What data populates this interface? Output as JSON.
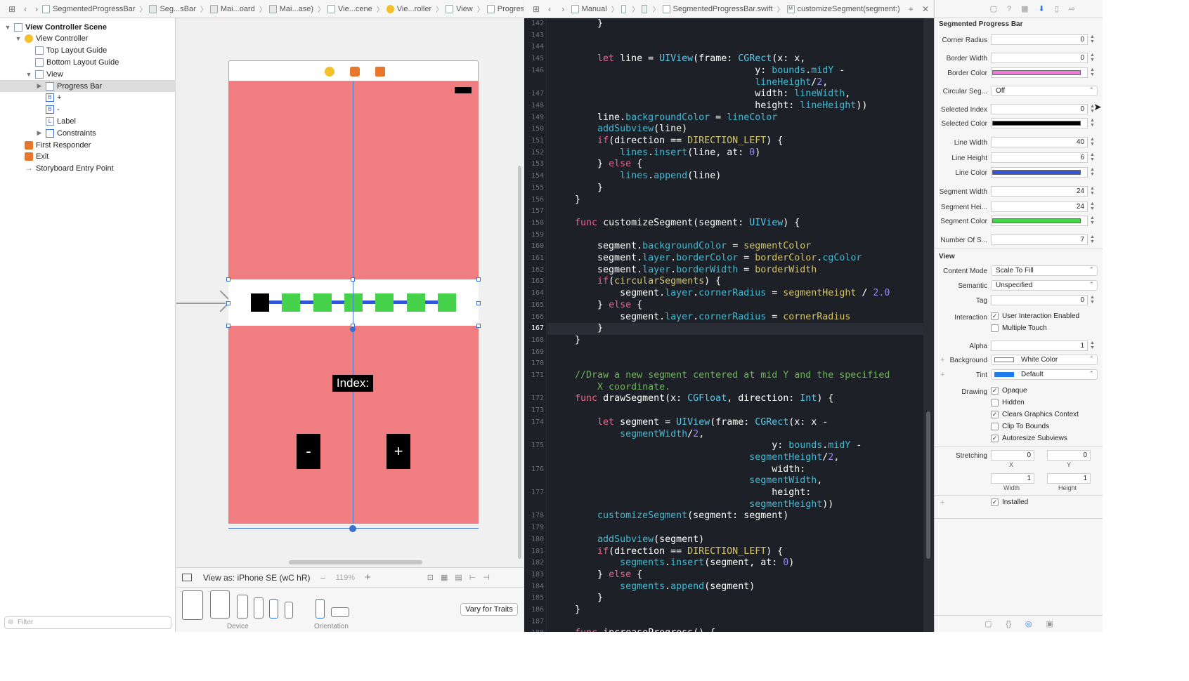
{
  "breadcrumbs": [
    "SegmentedProgressBar",
    "Seg...sBar",
    "Mai...oard",
    "Mai...ase)",
    "Vie...cene",
    "Vie...roller",
    "View",
    "Progress Bar"
  ],
  "editor_breadcrumbs": [
    "Manual",
    "SegmentedProgressBar.swift",
    "customizeSegment(segment:)"
  ],
  "outline": {
    "items": [
      {
        "label": "View Controller Scene",
        "depth": 0,
        "bold": true,
        "icon": "scene-icon",
        "tri": "▼"
      },
      {
        "label": "View Controller",
        "depth": 1,
        "icon": "view-controller-icon",
        "tri": "▼"
      },
      {
        "label": "Top Layout Guide",
        "depth": 2,
        "icon": "layout-guide-icon",
        "tri": ""
      },
      {
        "label": "Bottom Layout Guide",
        "depth": 2,
        "icon": "layout-guide-icon",
        "tri": ""
      },
      {
        "label": "View",
        "depth": 2,
        "icon": "view-icon",
        "tri": "▼"
      },
      {
        "label": "Progress Bar",
        "depth": 3,
        "icon": "view-icon",
        "tri": "▶",
        "selected": true
      },
      {
        "label": "+",
        "depth": 3,
        "icon": "button-icon",
        "tri": "",
        "glyph": "B"
      },
      {
        "label": "-",
        "depth": 3,
        "icon": "button-icon",
        "tri": "",
        "glyph": "B"
      },
      {
        "label": "Label",
        "depth": 3,
        "icon": "label-icon",
        "tri": "",
        "glyph": "L"
      },
      {
        "label": "Constraints",
        "depth": 3,
        "icon": "constraints-icon",
        "tri": "▶"
      },
      {
        "label": "First Responder",
        "depth": 1,
        "icon": "first-responder-icon",
        "tri": ""
      },
      {
        "label": "Exit",
        "depth": 1,
        "icon": "exit-icon",
        "tri": ""
      },
      {
        "label": "Storyboard Entry Point",
        "depth": 1,
        "icon": "entry-point-icon",
        "tri": ""
      }
    ],
    "filter_placeholder": "Filter"
  },
  "canvas": {
    "index_label": "Index:",
    "minus_label": "-",
    "plus_label": "+",
    "view_as": "View as: iPhone SE (wC hR)",
    "zoom": "119%",
    "device_caption": "Device",
    "orientation_caption": "Orientation",
    "vary_button": "Vary for Traits"
  },
  "code": {
    "first_line": 142,
    "current_line": 167,
    "lines": [
      [
        142,
        [
          [
            "w",
            "        }"
          ]
        ]
      ],
      [
        143,
        []
      ],
      [
        144,
        []
      ],
      [
        145,
        [
          [
            "k",
            "        let "
          ],
          [
            "w",
            "line = "
          ],
          [
            "t",
            "UIView"
          ],
          [
            "w",
            "(frame: "
          ],
          [
            "t",
            "CGRect"
          ],
          [
            "w",
            "(x: x,"
          ]
        ]
      ],
      [
        146,
        [
          [
            "w",
            "                                    y: "
          ],
          [
            "p",
            "bounds"
          ],
          [
            "w",
            "."
          ],
          [
            "p",
            "midY"
          ],
          [
            "w",
            " -"
          ]
        ]
      ],
      [
        0,
        [
          [
            "w",
            "                                    "
          ],
          [
            "p",
            "lineHeight"
          ],
          [
            "w",
            "/"
          ],
          [
            "n",
            "2"
          ],
          [
            "w",
            ","
          ]
        ]
      ],
      [
        147,
        [
          [
            "w",
            "                                    width: "
          ],
          [
            "p",
            "lineWidth"
          ],
          [
            "w",
            ","
          ]
        ]
      ],
      [
        148,
        [
          [
            "w",
            "                                    height: "
          ],
          [
            "p",
            "lineHeight"
          ],
          [
            "w",
            "))"
          ]
        ]
      ],
      [
        149,
        [
          [
            "w",
            "        line."
          ],
          [
            "p",
            "backgroundColor"
          ],
          [
            "w",
            " = "
          ],
          [
            "p",
            "lineColor"
          ]
        ]
      ],
      [
        150,
        [
          [
            "w",
            "        "
          ],
          [
            "p",
            "addSubview"
          ],
          [
            "w",
            "(line)"
          ]
        ]
      ],
      [
        151,
        [
          [
            "k",
            "        if"
          ],
          [
            "w",
            "(direction == "
          ],
          [
            "s",
            "DIRECTION_LEFT"
          ],
          [
            "w",
            ") {"
          ]
        ]
      ],
      [
        152,
        [
          [
            "w",
            "            "
          ],
          [
            "p",
            "lines"
          ],
          [
            "w",
            "."
          ],
          [
            "p",
            "insert"
          ],
          [
            "w",
            "(line, at: "
          ],
          [
            "n",
            "0"
          ],
          [
            "w",
            ")"
          ]
        ]
      ],
      [
        153,
        [
          [
            "w",
            "        } "
          ],
          [
            "k",
            "else"
          ],
          [
            "w",
            " {"
          ]
        ]
      ],
      [
        154,
        [
          [
            "w",
            "            "
          ],
          [
            "p",
            "lines"
          ],
          [
            "w",
            "."
          ],
          [
            "p",
            "append"
          ],
          [
            "w",
            "(line)"
          ]
        ]
      ],
      [
        155,
        [
          [
            "w",
            "        }"
          ]
        ]
      ],
      [
        156,
        [
          [
            "w",
            "    }"
          ]
        ]
      ],
      [
        157,
        []
      ],
      [
        158,
        [
          [
            "k",
            "    func "
          ],
          [
            "w",
            "customizeSegment(segment: "
          ],
          [
            "t",
            "UIView"
          ],
          [
            "w",
            ") {"
          ]
        ]
      ],
      [
        159,
        []
      ],
      [
        160,
        [
          [
            "w",
            "        segment."
          ],
          [
            "p",
            "backgroundColor"
          ],
          [
            "w",
            " = "
          ],
          [
            "s",
            "segmentColor"
          ]
        ]
      ],
      [
        161,
        [
          [
            "w",
            "        segment."
          ],
          [
            "p",
            "layer"
          ],
          [
            "w",
            "."
          ],
          [
            "p",
            "borderColor"
          ],
          [
            "w",
            " = "
          ],
          [
            "s",
            "borderColor"
          ],
          [
            "w",
            "."
          ],
          [
            "p",
            "cgColor"
          ]
        ]
      ],
      [
        162,
        [
          [
            "w",
            "        segment."
          ],
          [
            "p",
            "layer"
          ],
          [
            "w",
            "."
          ],
          [
            "p",
            "borderWidth"
          ],
          [
            "w",
            " = "
          ],
          [
            "s",
            "borderWidth"
          ]
        ]
      ],
      [
        163,
        [
          [
            "k",
            "        if"
          ],
          [
            "w",
            "("
          ],
          [
            "s",
            "circularSegments"
          ],
          [
            "w",
            ") {"
          ]
        ]
      ],
      [
        164,
        [
          [
            "w",
            "            segment."
          ],
          [
            "p",
            "layer"
          ],
          [
            "w",
            "."
          ],
          [
            "p",
            "cornerRadius"
          ],
          [
            "w",
            " = "
          ],
          [
            "s",
            "segmentHeight"
          ],
          [
            "w",
            " / "
          ],
          [
            "n",
            "2.0"
          ]
        ]
      ],
      [
        165,
        [
          [
            "w",
            "        } "
          ],
          [
            "k",
            "else"
          ],
          [
            "w",
            " {"
          ]
        ]
      ],
      [
        166,
        [
          [
            "w",
            "            segment."
          ],
          [
            "p",
            "layer"
          ],
          [
            "w",
            "."
          ],
          [
            "p",
            "cornerRadius"
          ],
          [
            "w",
            " = "
          ],
          [
            "s",
            "cornerRadius"
          ]
        ]
      ],
      [
        167,
        [
          [
            "w",
            "        }"
          ]
        ]
      ],
      [
        168,
        [
          [
            "w",
            "    }"
          ]
        ]
      ],
      [
        169,
        []
      ],
      [
        170,
        []
      ],
      [
        171,
        [
          [
            "c",
            "    //Draw a new segment centered at mid Y and the specified"
          ]
        ]
      ],
      [
        0,
        [
          [
            "c",
            "        X coordinate."
          ]
        ]
      ],
      [
        172,
        [
          [
            "k",
            "    func "
          ],
          [
            "w",
            "drawSegment(x: "
          ],
          [
            "t",
            "CGFloat"
          ],
          [
            "w",
            ", direction: "
          ],
          [
            "t",
            "Int"
          ],
          [
            "w",
            ") {"
          ]
        ]
      ],
      [
        173,
        []
      ],
      [
        174,
        [
          [
            "k",
            "        let "
          ],
          [
            "w",
            "segment = "
          ],
          [
            "t",
            "UIView"
          ],
          [
            "w",
            "(frame: "
          ],
          [
            "t",
            "CGRect"
          ],
          [
            "w",
            "(x: x -"
          ]
        ]
      ],
      [
        0,
        [
          [
            "w",
            "            "
          ],
          [
            "p",
            "segmentWidth"
          ],
          [
            "w",
            "/"
          ],
          [
            "n",
            "2"
          ],
          [
            "w",
            ","
          ]
        ]
      ],
      [
        175,
        [
          [
            "w",
            "                                       y: "
          ],
          [
            "p",
            "bounds"
          ],
          [
            "w",
            "."
          ],
          [
            "p",
            "midY"
          ],
          [
            "w",
            " -"
          ]
        ]
      ],
      [
        0,
        [
          [
            "w",
            "                                   "
          ],
          [
            "p",
            "segmentHeight"
          ],
          [
            "w",
            "/"
          ],
          [
            "n",
            "2"
          ],
          [
            "w",
            ","
          ]
        ]
      ],
      [
        176,
        [
          [
            "w",
            "                                       width:"
          ]
        ]
      ],
      [
        0,
        [
          [
            "w",
            "                                   "
          ],
          [
            "p",
            "segmentWidth"
          ],
          [
            "w",
            ","
          ]
        ]
      ],
      [
        177,
        [
          [
            "w",
            "                                       height:"
          ]
        ]
      ],
      [
        0,
        [
          [
            "w",
            "                                   "
          ],
          [
            "p",
            "segmentHeight"
          ],
          [
            "w",
            "))"
          ]
        ]
      ],
      [
        178,
        [
          [
            "w",
            "        "
          ],
          [
            "p",
            "customizeSegment"
          ],
          [
            "w",
            "(segment: segment)"
          ]
        ]
      ],
      [
        179,
        []
      ],
      [
        180,
        [
          [
            "w",
            "        "
          ],
          [
            "p",
            "addSubview"
          ],
          [
            "w",
            "(segment)"
          ]
        ]
      ],
      [
        181,
        [
          [
            "k",
            "        if"
          ],
          [
            "w",
            "(direction == "
          ],
          [
            "s",
            "DIRECTION_LEFT"
          ],
          [
            "w",
            ") {"
          ]
        ]
      ],
      [
        182,
        [
          [
            "w",
            "            "
          ],
          [
            "p",
            "segments"
          ],
          [
            "w",
            "."
          ],
          [
            "p",
            "insert"
          ],
          [
            "w",
            "(segment, at: "
          ],
          [
            "n",
            "0"
          ],
          [
            "w",
            ")"
          ]
        ]
      ],
      [
        183,
        [
          [
            "w",
            "        } "
          ],
          [
            "k",
            "else"
          ],
          [
            "w",
            " {"
          ]
        ]
      ],
      [
        184,
        [
          [
            "w",
            "            "
          ],
          [
            "p",
            "segments"
          ],
          [
            "w",
            "."
          ],
          [
            "p",
            "append"
          ],
          [
            "w",
            "(segment)"
          ]
        ]
      ],
      [
        185,
        [
          [
            "w",
            "        }"
          ]
        ]
      ],
      [
        186,
        [
          [
            "w",
            "    }"
          ]
        ]
      ],
      [
        187,
        []
      ],
      [
        188,
        [
          [
            "k",
            "    func "
          ],
          [
            "w",
            "increaseProgress() {"
          ]
        ]
      ]
    ]
  },
  "inspector": {
    "section_title": "Segmented Progress Bar",
    "fields": [
      {
        "label": "Corner Radius",
        "value": "0",
        "kind": "num"
      },
      {
        "label": "Border Width",
        "value": "0",
        "kind": "num"
      },
      {
        "label": "Border Color",
        "color": "#f07ad9",
        "kind": "color"
      },
      {
        "label": "Circular Seg...",
        "value": "Off",
        "kind": "pop"
      },
      {
        "label": "Selected Index",
        "value": "0",
        "kind": "num"
      },
      {
        "label": "Selected Color",
        "color": "#000000",
        "kind": "color"
      },
      {
        "label": "Line Width",
        "value": "40",
        "kind": "num"
      },
      {
        "label": "Line Height",
        "value": "6",
        "kind": "num"
      },
      {
        "label": "Line Color",
        "color": "#3454d9",
        "kind": "color"
      },
      {
        "label": "Segment Width",
        "value": "24",
        "kind": "num"
      },
      {
        "label": "Segment Hei...",
        "value": "24",
        "kind": "num"
      },
      {
        "label": "Segment Color",
        "color": "#46d24a",
        "kind": "color"
      },
      {
        "label": "Number Of S...",
        "value": "7",
        "kind": "num"
      }
    ],
    "view_title": "View",
    "content_mode_label": "Content Mode",
    "content_mode": "Scale To Fill",
    "semantic_label": "Semantic",
    "semantic": "Unspecified",
    "tag_label": "Tag",
    "tag": "0",
    "interaction_label": "Interaction",
    "user_interaction": "User Interaction Enabled",
    "multiple_touch": "Multiple Touch",
    "alpha_label": "Alpha",
    "alpha": "1",
    "background_label": "Background",
    "background": "White Color",
    "tint_label": "Tint",
    "tint": "Default",
    "drawing_label": "Drawing",
    "opaque": "Opaque",
    "hidden": "Hidden",
    "clears": "Clears Graphics Context",
    "clip": "Clip To Bounds",
    "autoresize": "Autoresize Subviews",
    "stretching_label": "Stretching",
    "stretch_x": "0",
    "stretch_y": "0",
    "stretch_w": "1",
    "stretch_h": "1",
    "x_cap": "X",
    "y_cap": "Y",
    "w_cap": "Width",
    "h_cap": "Height",
    "installed": "Installed"
  },
  "colors": {
    "view_pink": "#f07d80",
    "segment_green": "#46d24a",
    "line_blue": "#3454d9",
    "selected_black": "#000000"
  },
  "progress": {
    "segments": 7,
    "selected_index": 0
  }
}
